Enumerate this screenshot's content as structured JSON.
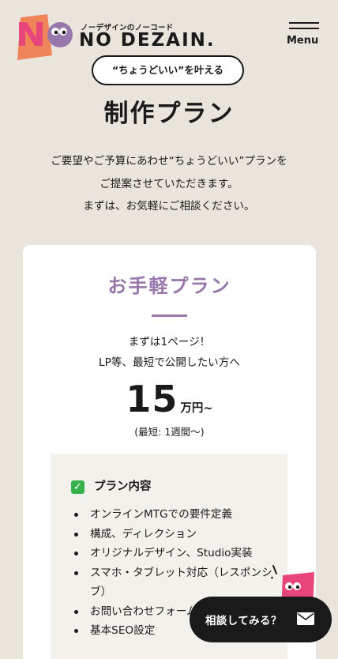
{
  "header": {
    "brand_sub": "ノーデザインのノーコード",
    "brand_name": "NO DEZAIN.",
    "menu_label": "Menu",
    "logo_icon": "no-dezain-logo-icon"
  },
  "hero": {
    "tagline": "“ちょうどいい”を叶える",
    "title": "制作プラン",
    "lead": [
      "ご要望やご予算にあわせ“ちょうどいい”プランを",
      "ご提案させていただきます。",
      "まずは、お気軽にご相談ください。"
    ]
  },
  "plan": {
    "name": "お手軽プラン",
    "desc": [
      "まずは1ページ！",
      "LP等、最短で公開したい方へ"
    ],
    "price": "15",
    "price_unit": "万円~",
    "duration": "(最短: 1週間〜)",
    "content_title": "プラン内容",
    "check_icon": "check-mark-icon",
    "features": [
      "オンラインMTGでの要件定義",
      "構成、ディレクション",
      "オリジナルデザイン、Studio実装",
      "スマホ・タブレット対応（レスポンシブ）",
      "お問い合わせフォーム",
      "基本SEO設定"
    ]
  },
  "floating": {
    "consult_label": "相談してみる？",
    "mail_icon": "mail-icon",
    "mascot_icon": "mascot-icon"
  },
  "colors": {
    "background": "#e9e5dc",
    "accent_purple": "#9877ad",
    "logo_orange": "#f0855a",
    "logo_pink": "#e8457a",
    "check_green": "#36b24a"
  }
}
